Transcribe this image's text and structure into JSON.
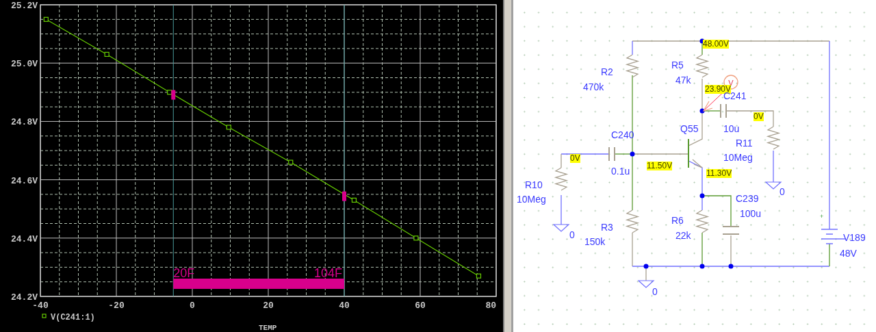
{
  "plot": {
    "chart_data": {
      "type": "line",
      "xlabel": "TEMP",
      "x": [
        -38.5,
        -22.5,
        -6,
        9.6,
        25.9,
        42.6,
        58.9,
        75.4
      ],
      "grid": true,
      "series": [
        {
          "name": "V(C241:1)",
          "color": "#66cc00",
          "marker": "square",
          "values": [
            25.15,
            25.03,
            24.9,
            24.78,
            24.66,
            24.53,
            24.4,
            24.27
          ]
        }
      ],
      "xlim": [
        -40,
        80
      ],
      "ylim": [
        24.2,
        25.2
      ],
      "xticks": [
        -40,
        -20,
        0,
        20,
        40,
        60,
        80
      ],
      "yticks": [
        {
          "value": 24.2,
          "label": "24.2V"
        },
        {
          "value": 24.4,
          "label": "24.4V"
        },
        {
          "value": 24.6,
          "label": "24.6V"
        },
        {
          "value": 24.8,
          "label": "24.8V"
        },
        {
          "value": 25.0,
          "label": "25.0V"
        },
        {
          "value": 25.2,
          "label": "25.2V"
        }
      ],
      "ref_lines": [
        {
          "axis": "x",
          "value": -5,
          "label": "20F"
        },
        {
          "axis": "x",
          "value": 40,
          "label": "104F"
        }
      ]
    }
  },
  "schematic": {
    "parts": [
      {
        "kind": "resistor",
        "name": "R2",
        "value": "470k"
      },
      {
        "kind": "resistor",
        "name": "R5",
        "value": "47k"
      },
      {
        "kind": "capacitor",
        "name": "C240",
        "value": "0.1u"
      },
      {
        "kind": "transistor",
        "name": "Q55"
      },
      {
        "kind": "capacitor",
        "name": "C241",
        "value": "10u"
      },
      {
        "kind": "resistor",
        "name": "R10",
        "value": "10Meg"
      },
      {
        "kind": "resistor",
        "name": "R11",
        "value": "10Meg"
      },
      {
        "kind": "resistor",
        "name": "R3",
        "value": "150k"
      },
      {
        "kind": "resistor",
        "name": "R6",
        "value": "22k"
      },
      {
        "kind": "capacitor",
        "name": "C239",
        "value": "100u"
      },
      {
        "kind": "battery",
        "name": "V189",
        "value": "48V"
      }
    ],
    "voltages": [
      "48.00V",
      "23.90V",
      "0V",
      "0V",
      "11.50V",
      "11.30V"
    ],
    "grounds": [
      "0",
      "0",
      "0"
    ],
    "probe": {
      "label": "V"
    },
    "battery_signs": [
      "+",
      "-"
    ]
  }
}
